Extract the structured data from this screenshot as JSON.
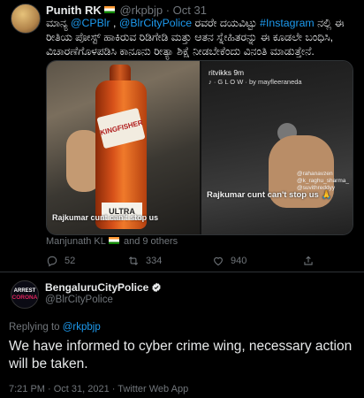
{
  "tweet1": {
    "name": "Punith RK",
    "handle": "@rkpbjp",
    "sep": "·",
    "date": "Oct 31",
    "text_mention1": "@CPBlr",
    "text_mention2": "@BlrCityPolice",
    "text_hashtag": "#Instagram",
    "text_prefix": "ಮಾನ್ಯ",
    "text_comma": " ,",
    "text_mid": " ರವರೇ ದಯವಿಟ್ಟು",
    "text_rest": " ನಲ್ಲಿ ಈ ರೀತಿಯ ಪೋಸ್ಟ್ ಹಾಕಿರುವ ರಿಡಿಗೇಡಿ ಮತ್ತು ಆತನ ಸ್ನೇಹಿತರನ್ನು ಈ ಕೂಡಲೇ ಬಂಧಿಸಿ, ವಿಚಾರಣೆಗೊಳಪಡಿಸಿ ಕಾನೂನು ರೀತ್ಯಾ ಶಿಕ್ಷೆ ನೀಡಬೇಕೆಂದು ವಿನಂತಿ ಮಾಡುತ್ತೇನೆ.",
    "media": {
      "left_label_top": "KINGFISHER",
      "left_label_bottom": "ULTRA",
      "left_overlay": "Rajkumar cunt can't stop us",
      "right_story_user": "ritvikks  9m",
      "right_story_music": "♪ · G L O W · by mayfleeraneda",
      "right_tagged": "@rahanavzen\n@k_raghu_sharma_\n@suvithreddyy",
      "right_overlay": "Rajkumar cunt can't stop us 🙏"
    },
    "likes_line_name": "Manjunath KL",
    "likes_line_rest": "and 9 others",
    "actions": {
      "reply_count": "52",
      "retweet_count": "334",
      "like_count": "940"
    }
  },
  "tweet2": {
    "avatar_line1": "ARREST",
    "avatar_line2": "CORONA",
    "name": "BengaluruCityPolice",
    "handle": "@BlrCityPolice",
    "replying_prefix": "Replying to",
    "replying_handle": "@rkpbjp",
    "body": "We have informed to cyber crime wing, necessary action will be taken.",
    "timestamp": "7:21 PM · Oct 31, 2021 · Twitter Web App"
  },
  "colors": {
    "background": "#000000",
    "text": "#e7e9ea",
    "muted": "#71767b",
    "link": "#1d9bf0",
    "divider": "#2f3336",
    "verified": "#1d9bf0"
  }
}
